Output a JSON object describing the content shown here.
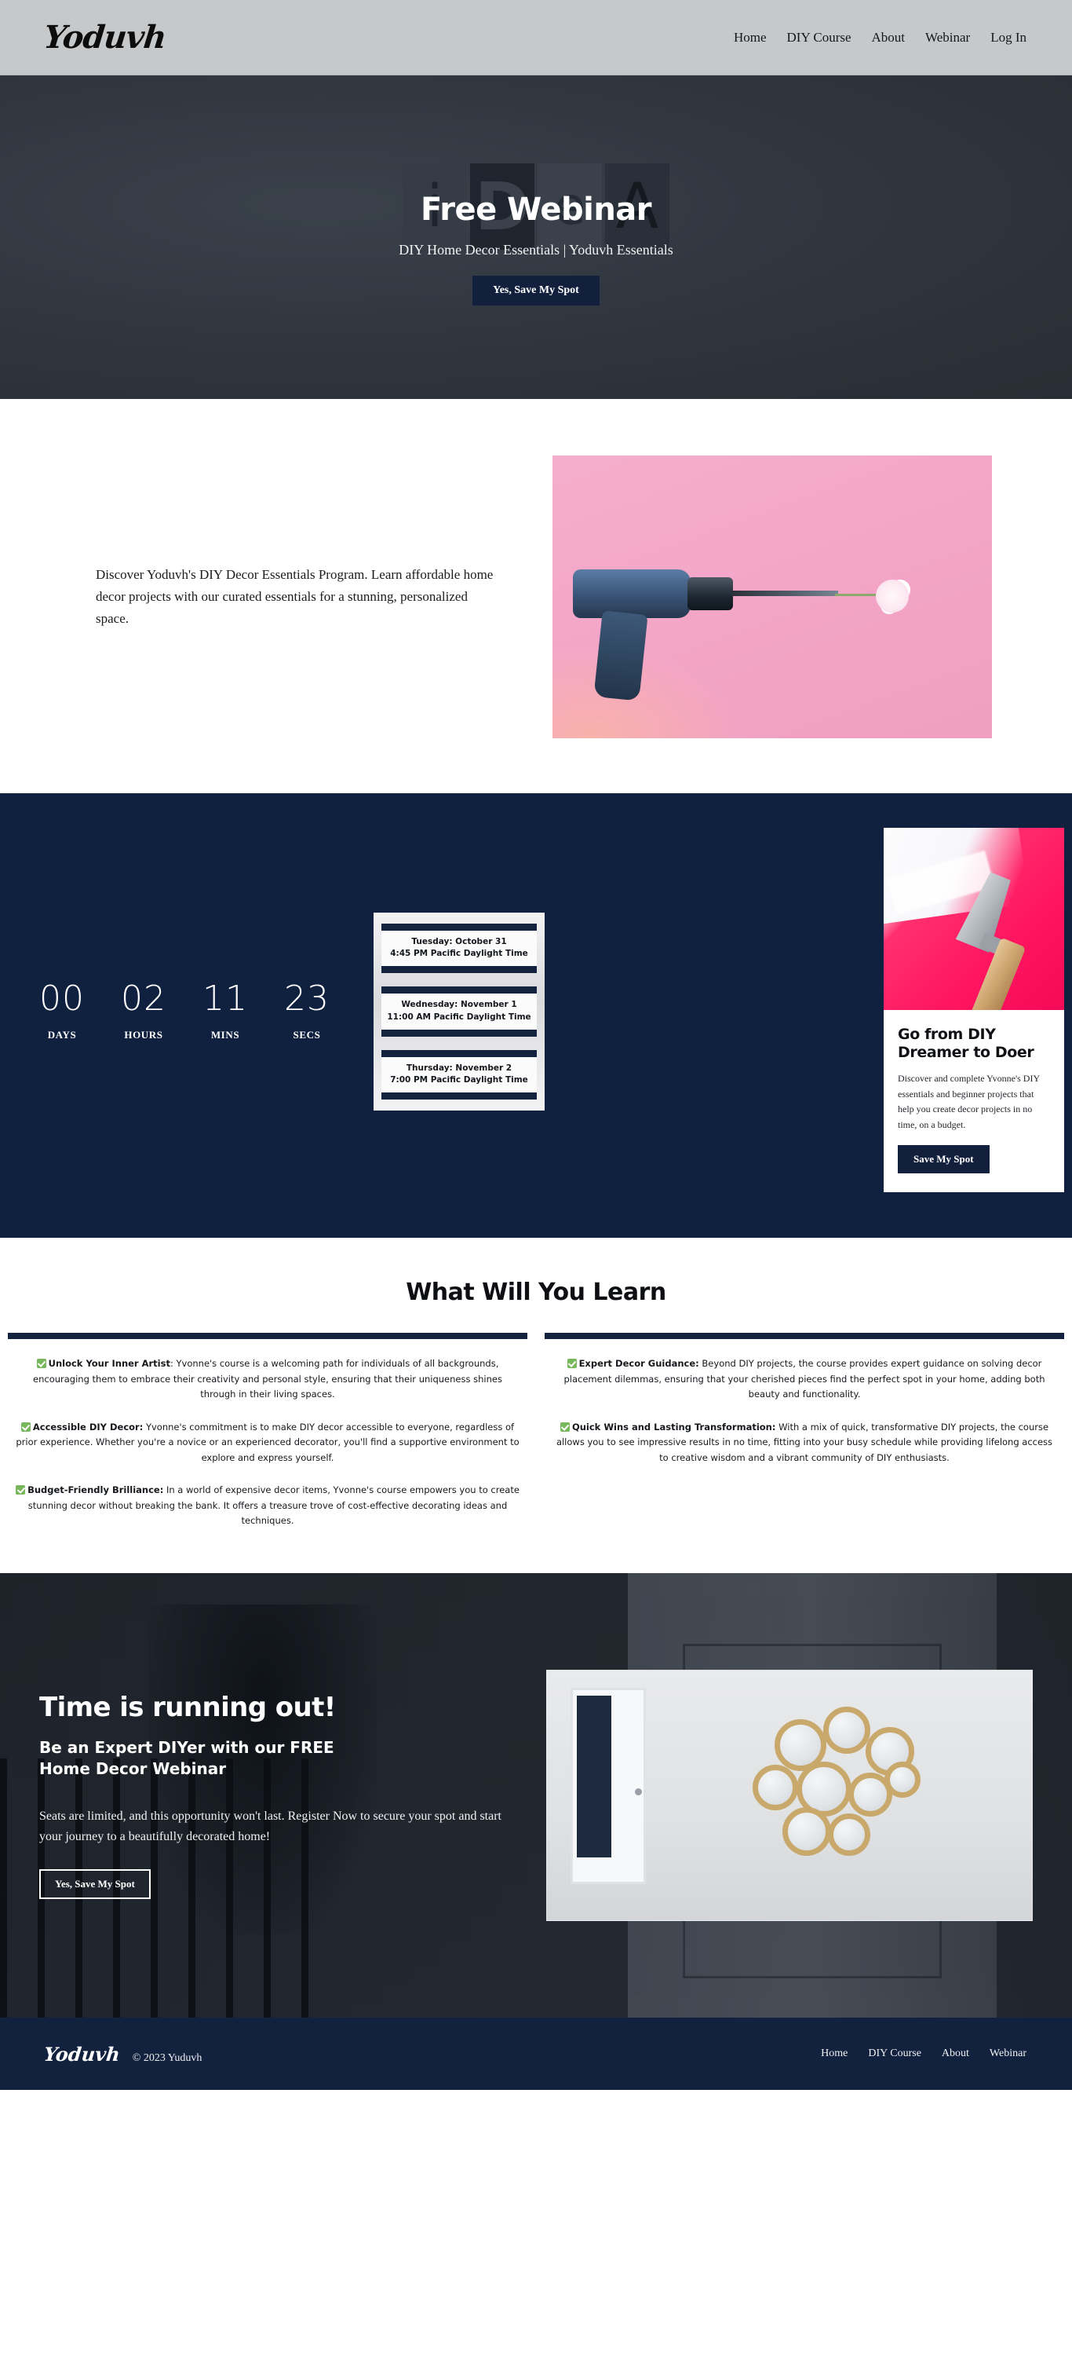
{
  "header": {
    "logo": "Yoduvh",
    "nav": [
      {
        "label": "Home"
      },
      {
        "label": "DIY Course"
      },
      {
        "label": "About"
      },
      {
        "label": "Webinar"
      },
      {
        "label": "Log In"
      }
    ]
  },
  "hero": {
    "background_letters": [
      "i",
      "D",
      "e",
      "A"
    ],
    "title": "Free Webinar",
    "subtitle": "DIY Home Decor Essentials | Yoduvh Essentials",
    "cta_label": "Yes, Save My Spot"
  },
  "intro": {
    "paragraph": "Discover Yoduvh's DIY Decor Essentials Program. Learn affordable home decor projects with our curated essentials for a stunning, personalized space.",
    "image_alt": "drill-and-flower-photo"
  },
  "countdown": {
    "units": [
      {
        "value": "00",
        "label": "DAYS"
      },
      {
        "value": "02",
        "label": "HOURS"
      },
      {
        "value": "11",
        "label": "MINS"
      },
      {
        "value": "23",
        "label": "SECS"
      }
    ]
  },
  "schedule": {
    "sessions": [
      {
        "date": "Tuesday: October 31",
        "time": "4:45 PM Pacific Daylight Time"
      },
      {
        "date": "Wednesday: November 1",
        "time": "11:00 AM Pacific Daylight Time"
      },
      {
        "date": "Thursday: November 2",
        "time": "7:00 PM Pacific Daylight Time"
      }
    ]
  },
  "dreamer_card": {
    "image_alt": "paint-scraper-pink-photo",
    "title": "Go from DIY Dreamer to Doer",
    "text": "Discover and complete Yvonne's DIY essentials and beginner projects that help you create decor projects in no time, on a budget.",
    "cta_label": "Save My Spot"
  },
  "learn": {
    "title": "What Will You Learn",
    "left_bullets": [
      {
        "heading": "Unlock Your Inner Artist",
        "separator": ": ",
        "body": "Yvonne's course is a welcoming path for individuals of all backgrounds, encouraging them to embrace their creativity and personal style, ensuring that their uniqueness shines through in their living spaces."
      },
      {
        "heading": "Accessible DIY Decor:",
        "separator": " ",
        "body": "Yvonne's commitment is to make DIY decor accessible to everyone, regardless of prior experience. Whether you're a novice or an experienced decorator, you'll find a supportive environment to explore and express yourself."
      },
      {
        "heading": "Budget-Friendly Brilliance:",
        "separator": " ",
        "body": "In a world of expensive decor items, Yvonne's course empowers you to create stunning decor without breaking the bank. It offers a treasure trove of cost-effective decorating ideas and techniques."
      }
    ],
    "right_bullets": [
      {
        "heading": "Expert Decor Guidance:",
        "separator": " ",
        "body": "Beyond DIY projects, the course provides expert guidance on solving decor placement dilemmas, ensuring that your cherished pieces find the perfect spot in your home, adding both beauty and functionality."
      },
      {
        "heading": "Quick Wins and Lasting Transformation:",
        "separator": " ",
        "body": "With a mix of quick, transformative DIY projects, the course allows you to see impressive results in no time, fitting into your busy schedule while providing lifelong access to creative wisdom and a vibrant community of DIY enthusiasts."
      }
    ]
  },
  "cta": {
    "headline": "Time is running out!",
    "subheadline": "Be an Expert DIYer with our FREE Home Decor Webinar",
    "paragraph": "Seats are limited, and this opportunity won't last. Register Now to secure your spot and start your journey to a beautifully decorated home!",
    "button_label": "Yes, Save My Spot",
    "image_alt": "gold-circle-mirrors-wall-photo"
  },
  "footer": {
    "logo": "Yoduvh",
    "copyright": "© 2023 Yuduvh",
    "nav": [
      {
        "label": "Home"
      },
      {
        "label": "DIY Course"
      },
      {
        "label": "About"
      },
      {
        "label": "Webinar"
      }
    ]
  },
  "colors": {
    "header_bg": "#c6c8ca",
    "hero_bg": "#31373f",
    "navy": "#12203d",
    "deep_navy": "#10203f",
    "check_green": "#78b75b",
    "pink": "#f4a7c8",
    "hot_pink": "#ff1460"
  }
}
